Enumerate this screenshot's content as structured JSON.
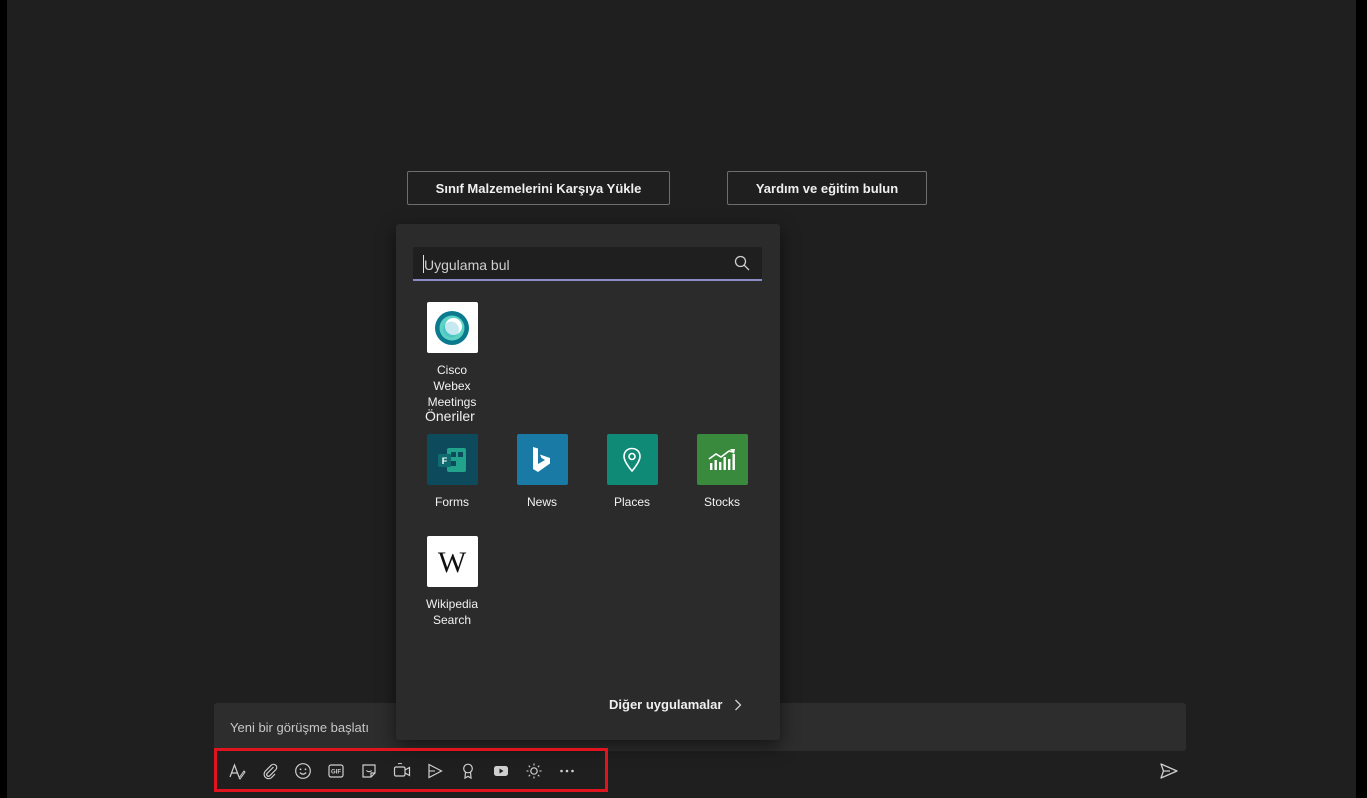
{
  "buttons": {
    "upload": "Sınıf Malzemelerini Karşıya Yükle",
    "help": "Yardım ve eğitim bulun"
  },
  "app_picker": {
    "search_placeholder": "Uygulama bul",
    "installed": [
      {
        "label": "Cisco Webex Meetings"
      }
    ],
    "suggestions_label": "Öneriler",
    "suggestions": [
      {
        "label": "Forms",
        "color": "#0d4b5c"
      },
      {
        "label": "News",
        "color": "#1a7aa6"
      },
      {
        "label": "Places",
        "color": "#0e8a76"
      },
      {
        "label": "Stocks",
        "color": "#3a8a3e"
      },
      {
        "label": "Wikipedia Search",
        "color": "#ffffff"
      }
    ],
    "more_apps": "Diğer uygulamalar"
  },
  "compose": {
    "placeholder": "Yeni bir görüşme başlatı"
  },
  "toolbar": {
    "icons": [
      "format-icon",
      "attach-icon",
      "emoji-icon",
      "gif-icon",
      "sticker-icon",
      "meet-now-icon",
      "stream-icon",
      "praise-icon",
      "youtube-icon",
      "brightness-icon",
      "more-options-icon"
    ],
    "highlight_color": "#e0141e"
  }
}
